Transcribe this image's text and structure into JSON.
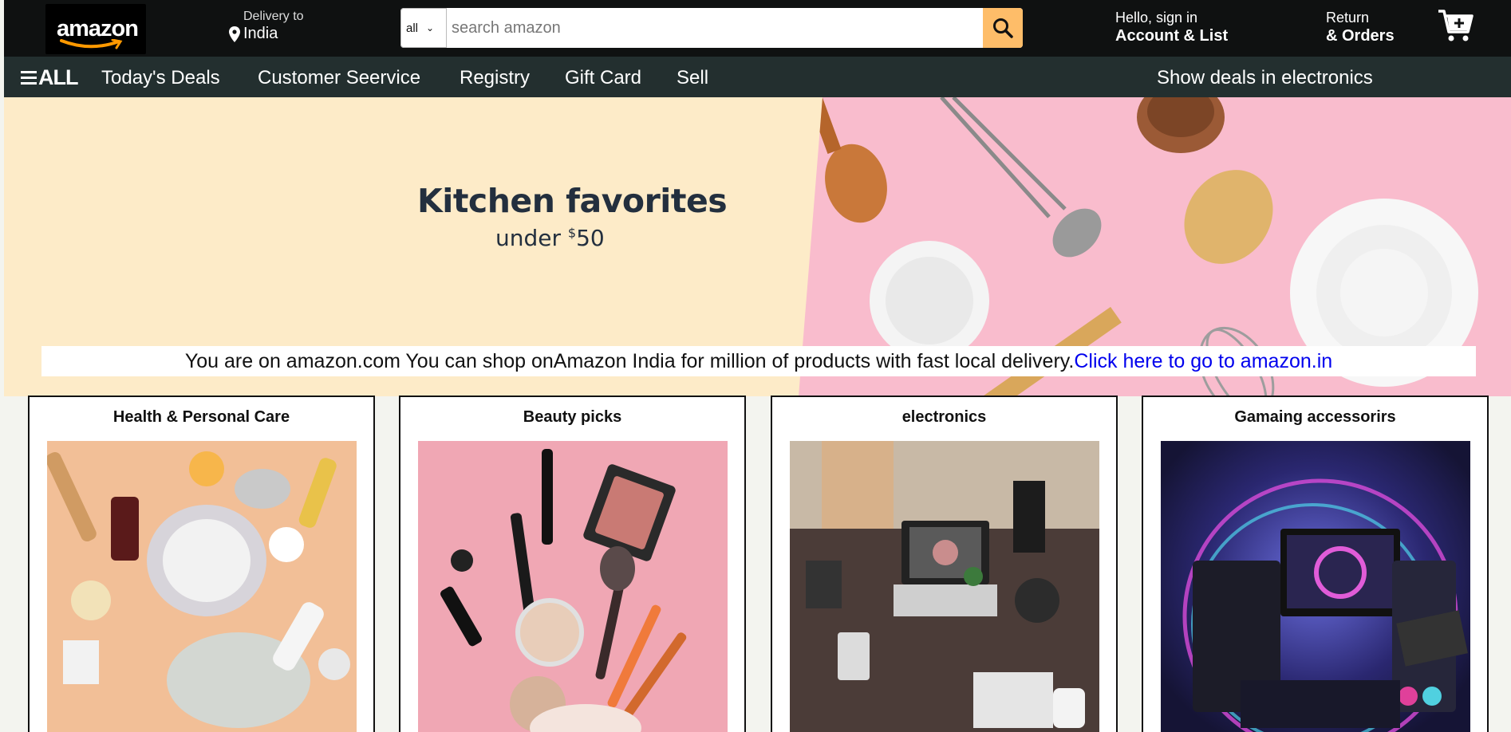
{
  "header": {
    "logo_text": "amazon",
    "delivery_label": "Delivery to",
    "delivery_location": "India",
    "search_category": "all",
    "search_placeholder": "search amazon",
    "account_greeting": "Hello, sign in",
    "account_label": "Account & List",
    "returns_label": "Return",
    "orders_label": "& Orders",
    "colors": {
      "topbar": "#0f1111",
      "search_button": "#febd69"
    }
  },
  "subnav": {
    "all_label": "ALL",
    "items": [
      "Today's Deals",
      "Customer Seervice",
      "Registry",
      "Gift Card",
      "Sell"
    ],
    "promo": "Show deals in electronics",
    "color": "#232f2f"
  },
  "hero": {
    "title": "Kitchen favorites",
    "subtitle_prefix": "under ",
    "subtitle_currency": "$",
    "subtitle_amount": "50",
    "left_color": "#fdebc8",
    "right_color": "#f9bccd"
  },
  "notice": {
    "text": "You are on amazon.com You can shop onAmazon India for million of products with fast local delivery.",
    "link_text": "Click here to go to amazon.in"
  },
  "cards": [
    {
      "title": "Health & Personal Care",
      "image": "skincare-products-image"
    },
    {
      "title": "Beauty picks",
      "image": "makeup-products-image"
    },
    {
      "title": "electronics",
      "image": "desk-electronics-image"
    },
    {
      "title": "Gamaing accessorirs",
      "image": "gaming-pc-image"
    }
  ]
}
